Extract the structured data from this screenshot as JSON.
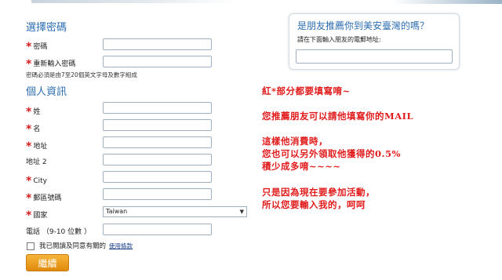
{
  "sections": {
    "password_title": "選擇密碼",
    "personal_title": "個人資訊"
  },
  "fields": {
    "password": "密碼",
    "password_confirm": "重新輸入密碼",
    "password_hint": "密碼必須是由7至20個英文字母及數字組成",
    "surname": "姓",
    "given_name": "名",
    "address": "地址",
    "address2": "地址 2",
    "city": "City",
    "postcode": "郵區號碼",
    "country": "國家",
    "country_value": "Taiwan",
    "phone": "電話 （9-10 位數 ）"
  },
  "agree": {
    "text": "我已閱讀及同意有關的",
    "link": "使用條款"
  },
  "continue_button": "繼續",
  "friend_box": {
    "title": "是朋友推薦你到美安臺灣的嗎？",
    "subtitle": "請在下面輸入朋友的電郵地址:"
  },
  "notes": [
    "紅*部分都要填寫唷~",
    "您推薦朋友可以請他填寫你的MAIL",
    "這樣他消費時，",
    "您也可以另外領取他獲得的0.5%",
    "積少成多唷~~~~",
    "只是因為現在要參加活動，",
    "所以您要輸入我的，呵呵"
  ],
  "colors": {
    "section_title": "#2d6db0",
    "required_star": "#d31f1f",
    "note_text": "#e11b1b",
    "button": "#f0a020"
  }
}
